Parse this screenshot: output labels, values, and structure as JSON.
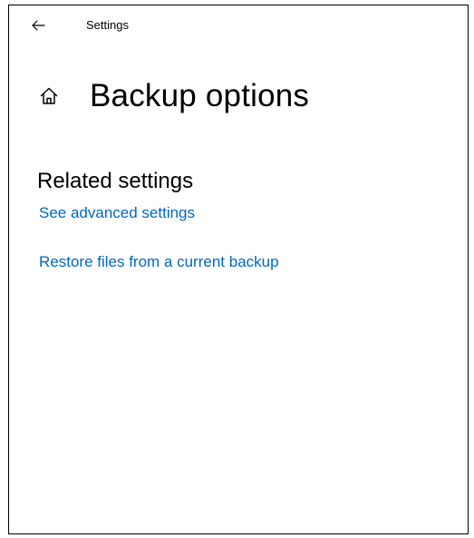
{
  "window": {
    "app_title": "Settings",
    "back_icon": "arrow-left-icon"
  },
  "header": {
    "home_icon": "home-icon",
    "title": "Backup options"
  },
  "related_settings": {
    "heading": "Related settings",
    "links": [
      {
        "label": "See advanced settings"
      },
      {
        "label": "Restore files from a current backup"
      }
    ]
  },
  "colors": {
    "link": "#0067c0",
    "text": "#000000",
    "background": "#ffffff",
    "border": "#000000"
  }
}
